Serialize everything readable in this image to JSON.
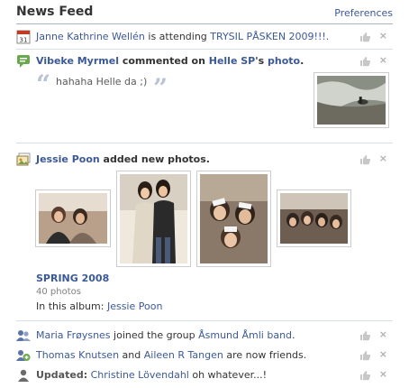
{
  "header": {
    "title": "News Feed",
    "preferences": "Preferences"
  },
  "story1": {
    "icon": "calendar-icon",
    "calendar_day": "31",
    "actor": "Janne Kathrine Wellén",
    "verb": " is attending ",
    "event": "TRYSIL PÅSKEN 2009!!!."
  },
  "story2": {
    "icon": "comment-icon",
    "actor": "Vibeke Myrmel",
    "verb": " commented on ",
    "target": "Helle SP",
    "suffix": "'s ",
    "object": "photo",
    "end": ".",
    "quote_text": "hahaha Helle da ;)"
  },
  "story3": {
    "icon": "photos-icon",
    "actor": "Jessie Poon",
    "verb": " added new photos.",
    "album_title": "SPRING 2008",
    "album_count": "40 photos",
    "album_in_label": "In this album: ",
    "album_in_name": "Jessie Poon"
  },
  "story4": {
    "icon": "group-icon",
    "actor": "Maria Frøysnes",
    "verb": " joined the group ",
    "group": "Åsmund Åmli band",
    "end": "."
  },
  "story5": {
    "icon": "friends-icon",
    "actor1": "Thomas Knutsen",
    "and": " and ",
    "actor2": "Aileen R Tangen",
    "verb": " are now friends."
  },
  "story6": {
    "icon": "profile-update-icon",
    "label": "Updated:",
    "actor": "Christine Lövendahl",
    "text": " oh whatever...!"
  },
  "controls": {
    "like_icon": "thumbs-up-icon",
    "remove": "×"
  },
  "colors": {
    "link": "#3b5998",
    "rule": "#d8dfea",
    "header_rule": "#a8b3c8",
    "muted": "#808080"
  }
}
